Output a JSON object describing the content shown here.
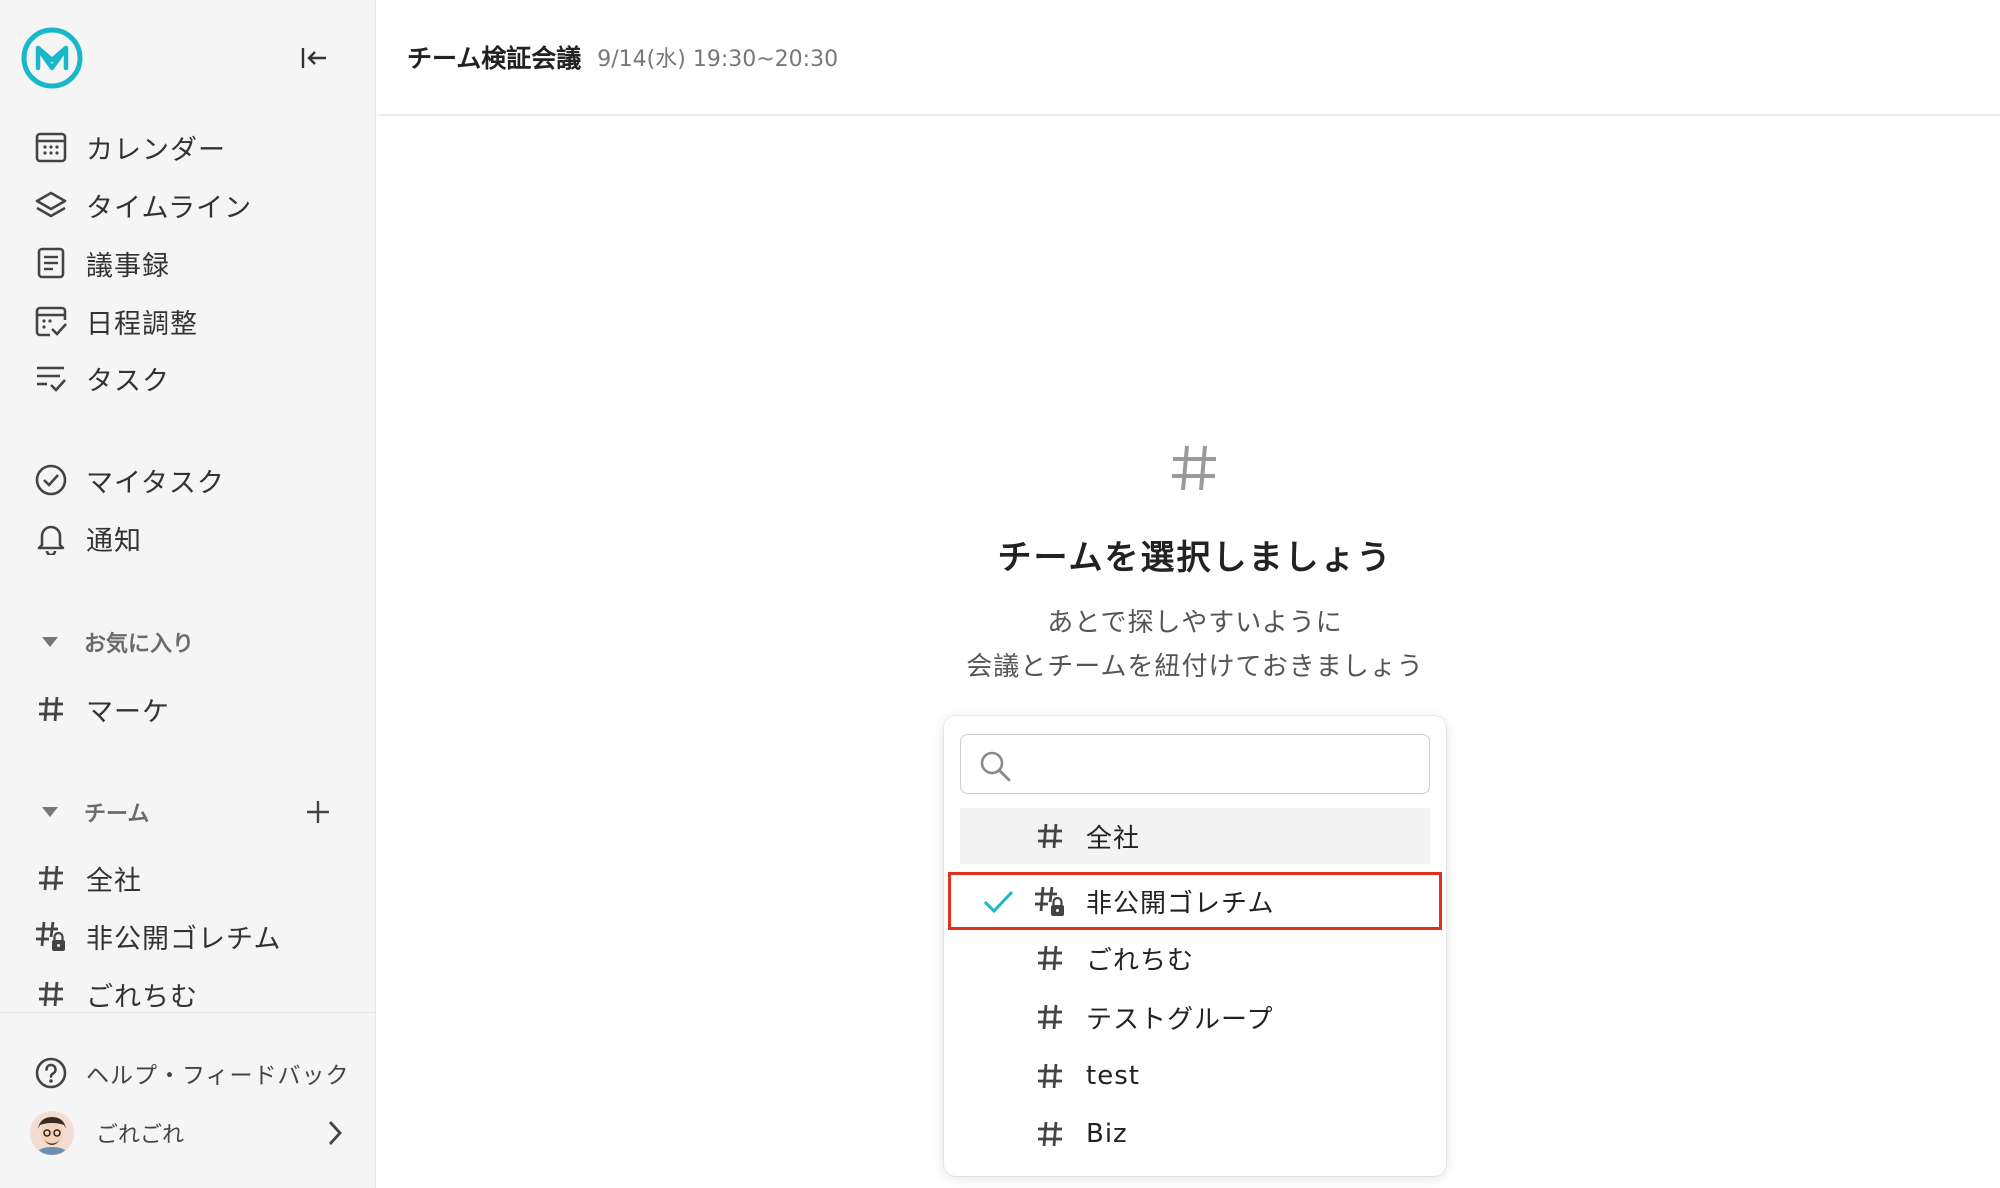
{
  "app": {
    "brand_color": "#18b7c9",
    "collapse_icon": "collapse-left-icon"
  },
  "sidebar": {
    "nav": [
      {
        "label": "カレンダー",
        "icon": "calendar-icon"
      },
      {
        "label": "タイムライン",
        "icon": "layers-icon"
      },
      {
        "label": "議事録",
        "icon": "document-icon"
      },
      {
        "label": "日程調整",
        "icon": "calendar-check-icon"
      },
      {
        "label": "タスク",
        "icon": "task-list-icon"
      }
    ],
    "personal": [
      {
        "label": "マイタスク",
        "icon": "check-circle-icon"
      },
      {
        "label": "通知",
        "icon": "bell-icon"
      }
    ],
    "favorites": {
      "label": "お気に入り",
      "items": [
        {
          "label": "マーケ",
          "icon": "hash-icon"
        }
      ]
    },
    "teams": {
      "label": "チーム",
      "add_icon": "plus-icon",
      "items": [
        {
          "label": "全社",
          "icon": "hash-icon"
        },
        {
          "label": "非公開ゴレチム",
          "icon": "hash-lock-icon"
        },
        {
          "label": "ごれちむ",
          "icon": "hash-icon"
        }
      ]
    },
    "help": {
      "label": "ヘルプ・フィードバック",
      "icon": "help-circle-icon"
    },
    "user": {
      "name": "ごれごれ",
      "chevron_icon": "chevron-right-icon"
    }
  },
  "header": {
    "title": "チーム検証会議",
    "datetime": "9/14(水) 19:30~20:30"
  },
  "empty_state": {
    "icon": "hash-icon",
    "title": "チームを選択しましょう",
    "desc_line1": "あとで探しやすいように",
    "desc_line2": "会議とチームを紐付けておきましょう"
  },
  "dropdown": {
    "search": {
      "value": "",
      "placeholder": ""
    },
    "options": [
      {
        "label": "全社",
        "icon": "hash-icon",
        "selected": false,
        "hovered": true
      },
      {
        "label": "非公開ゴレチム",
        "icon": "hash-lock-icon",
        "selected": true,
        "hovered": false
      },
      {
        "label": "ごれちむ",
        "icon": "hash-icon",
        "selected": false,
        "hovered": false
      },
      {
        "label": "テストグループ",
        "icon": "hash-icon",
        "selected": false,
        "hovered": false
      },
      {
        "label": "test",
        "icon": "hash-icon",
        "selected": false,
        "hovered": false
      },
      {
        "label": "Biz",
        "icon": "hash-icon",
        "selected": false,
        "hovered": false
      }
    ],
    "check_color": "#18b7c9",
    "highlight_color": "#e0311c"
  }
}
